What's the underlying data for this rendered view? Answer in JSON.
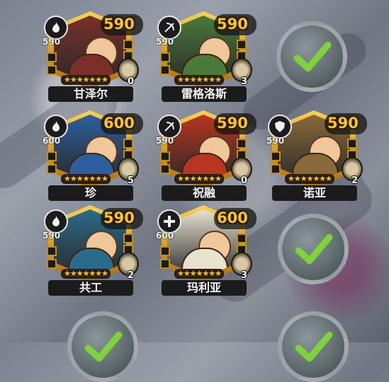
{
  "colors": {
    "power_text": "#f7c531",
    "frame_gold": "#e3a926",
    "check_green": "#7fd23a",
    "name_bar": "#1b1b1b"
  },
  "heroes": [
    {
      "name": "甘泽尔",
      "power": "590",
      "small": "590",
      "count": "0",
      "class_icon": "fire-icon",
      "stars": "★★★★★★★",
      "palette": "#7a2f2a"
    },
    {
      "name": "雷格洛斯",
      "power": "590",
      "small": "590",
      "count": "3",
      "class_icon": "bow-icon",
      "stars": "★★★★★★★",
      "palette": "#4a7a3a"
    },
    {
      "name": "珍",
      "power": "600",
      "small": "600",
      "count": "5",
      "class_icon": "fire-icon",
      "stars": "★★★★★★★",
      "palette": "#2d5e9e"
    },
    {
      "name": "祝融",
      "power": "590",
      "small": "590",
      "count": "0",
      "class_icon": "bow-icon",
      "stars": "★★★★★★★",
      "palette": "#b8351f"
    },
    {
      "name": "诺亚",
      "power": "590",
      "small": "590",
      "count": "2",
      "class_icon": "shield-icon",
      "stars": "★★★★★★★",
      "palette": "#8a6a3a"
    },
    {
      "name": "共工",
      "power": "590",
      "small": "590",
      "count": "2",
      "class_icon": "fire-icon",
      "stars": "★★★★★★★",
      "palette": "#2a6a8a"
    },
    {
      "name": "玛利亚",
      "power": "600",
      "small": "600",
      "count": "3",
      "class_icon": "cross-icon",
      "stars": "★★★★★★★",
      "palette": "#e8e2cf"
    }
  ]
}
